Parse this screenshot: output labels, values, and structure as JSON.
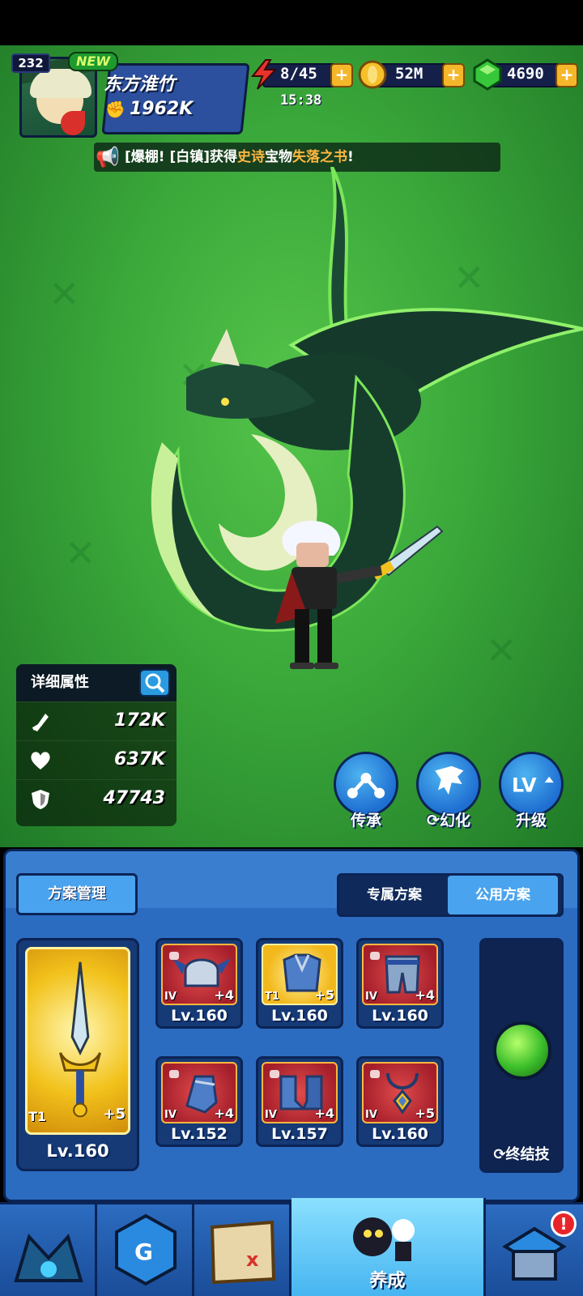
{
  "player": {
    "level": "232",
    "new_tag": "NEW",
    "name": "东方淮竹",
    "power": "1962K"
  },
  "resources": {
    "energy": "8/45",
    "energy_timer": "15:38",
    "gold": "52M",
    "gems": "4690",
    "plus": "+"
  },
  "broadcast": {
    "prefix": "[爆棚! [白镇]获得",
    "rarity": "史诗",
    "mid": "宝物",
    "item": "失落之书",
    "suffix": "!"
  },
  "stats": {
    "title": "详细属性",
    "attack": "172K",
    "hp": "637K",
    "defense": "47743"
  },
  "actions": {
    "inherit": "传承",
    "transform": "幻化",
    "upgrade": "升级"
  },
  "equipment": {
    "plan_management": "方案管理",
    "tabs": [
      "专属方案",
      "公用方案"
    ],
    "weapon": {
      "tier": "T1",
      "plus": "+5",
      "level": "Lv.160"
    },
    "slots": [
      {
        "tier": "IV",
        "plus": "+4",
        "level": "Lv.160"
      },
      {
        "tier": "T1",
        "plus": "+5",
        "level": "Lv.160"
      },
      {
        "tier": "IV",
        "plus": "+4",
        "level": "Lv.160"
      },
      {
        "tier": "IV",
        "plus": "+4",
        "level": "Lv.152"
      },
      {
        "tier": "IV",
        "plus": "+4",
        "level": "Lv.157"
      },
      {
        "tier": "IV",
        "plus": "+5",
        "level": "Lv.160"
      }
    ],
    "ultimate_label": "终结技"
  },
  "nav": {
    "active_label": "养成",
    "alert": "!"
  },
  "colors": {
    "scene_green": "#3aa83a",
    "panel_blue": "#2c6cc0",
    "epic_orange": "#ffb640",
    "gold": "#f2c21c"
  }
}
